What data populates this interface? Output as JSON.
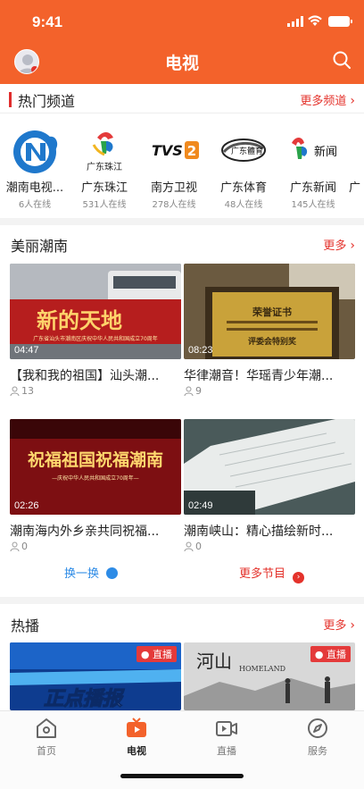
{
  "status": {
    "time": "9:41"
  },
  "header": {
    "title": "电视"
  },
  "hot_channels": {
    "title": "热门频道",
    "more": "更多频道",
    "items": [
      {
        "name": "潮南电视...",
        "online": "6人在线",
        "logo_text": ""
      },
      {
        "name": "广东珠江",
        "online": "531人在线",
        "logo_text": "广东珠江"
      },
      {
        "name": "南方卫视",
        "online": "278人在线",
        "logo_text": "TVS2"
      },
      {
        "name": "广东体育",
        "online": "48人在线",
        "logo_text": "广东體育"
      },
      {
        "name": "广东新闻",
        "online": "145人在线",
        "logo_text": "新闻"
      },
      {
        "name": "广",
        "online": "",
        "logo_text": ""
      }
    ]
  },
  "beautiful": {
    "title": "美丽潮南",
    "more": "更多",
    "videos": [
      {
        "title": "【我和我的祖国】汕头潮...",
        "duration": "04:47",
        "viewers": "13",
        "thumb_text": "新的天地",
        "thumb_sub": "广东省汕头市潮南区庆祝中华人民共和国成立70周年"
      },
      {
        "title": "华律潮音！华瑶青少年潮...",
        "duration": "08:23",
        "viewers": "9",
        "thumb_text": "荣誉证书",
        "thumb_sub": "评委会特别奖"
      },
      {
        "title": "潮南海内外乡亲共同祝福...",
        "duration": "02:26",
        "viewers": "0",
        "thumb_text": "祝福祖国祝福潮南",
        "thumb_sub": "—庆祝中华人民共和国成立70周年—"
      },
      {
        "title": "潮南峡山：精心描绘新时...",
        "duration": "02:49",
        "viewers": "0",
        "thumb_text": "",
        "thumb_sub": ""
      }
    ],
    "refresh": "换一换",
    "more_programs": "更多节目"
  },
  "hot_play": {
    "title": "热播",
    "more": "更多",
    "items": [
      {
        "badge": "直播",
        "thumb_text": "正点播报"
      },
      {
        "badge": "直播",
        "thumb_text": "河山",
        "thumb_sub": "HOMELAND"
      }
    ]
  },
  "tabbar": {
    "items": [
      {
        "label": "首页",
        "icon": "home-icon"
      },
      {
        "label": "电视",
        "icon": "tv-icon"
      },
      {
        "label": "直播",
        "icon": "live-video-icon"
      },
      {
        "label": "服务",
        "icon": "compass-icon"
      }
    ]
  },
  "colors": {
    "primary": "#f3622b",
    "accent_red": "#e4322b",
    "link_blue": "#2d8be6"
  }
}
